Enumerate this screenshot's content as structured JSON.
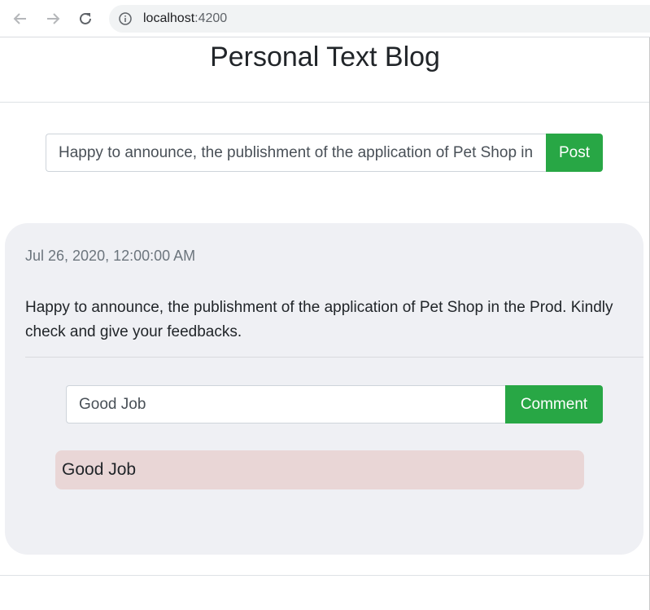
{
  "browser": {
    "url_host": "localhost",
    "url_port": ":4200",
    "icons": [
      "back-arrow-icon",
      "forward-arrow-icon",
      "reload-icon",
      "info-icon"
    ]
  },
  "header": {
    "title": "Personal Text Blog"
  },
  "composer": {
    "input_value": "Happy to announce, the publishment of the application of Pet Shop in the Prod. Kindly check and give your feedbacks.",
    "post_label": "Post"
  },
  "post": {
    "date": "Jul 26, 2020, 12:00:00 AM",
    "body": "Happy to announce, the publishment of the application of Pet Shop in the Prod. Kindly check and give your feedbacks.",
    "comment_input_value": "Good Job",
    "comment_label": "Comment",
    "comments": [
      {
        "text": "Good Job"
      }
    ]
  },
  "colors": {
    "accent_green": "#28a745",
    "card_bg": "#eff0f4",
    "comment_bg": "#e9d6d6"
  }
}
